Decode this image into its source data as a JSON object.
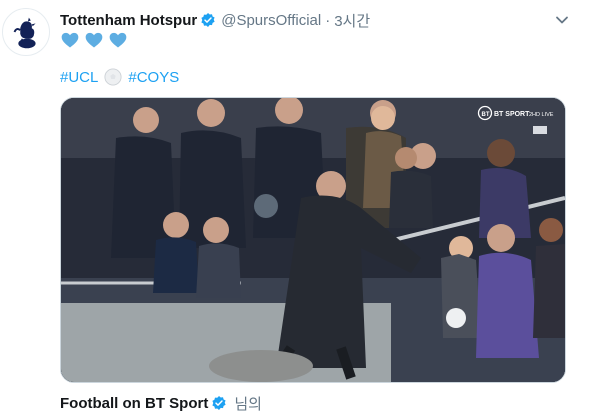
{
  "tweet": {
    "author_name": "Tottenham Hotspur",
    "handle": "@SpursOfficial",
    "separator": "·",
    "time": "3시간",
    "hearts": [
      "blue-heart",
      "blue-heart",
      "blue-heart"
    ],
    "hashtags": [
      "#UCL",
      "#COYS"
    ],
    "hashtag_separator_icon": "soccer-ball",
    "media": {
      "type": "video",
      "broadcaster_logo": "BT SPORT",
      "broadcaster_channel": "2HD LIVE"
    },
    "footer": {
      "via_name": "Football on BT Sport",
      "via_suffix": "님의"
    }
  },
  "colors": {
    "link": "#1da1f2",
    "verified": "#1da1f2",
    "secondary_text": "#657786",
    "heart": "#5dade2"
  }
}
